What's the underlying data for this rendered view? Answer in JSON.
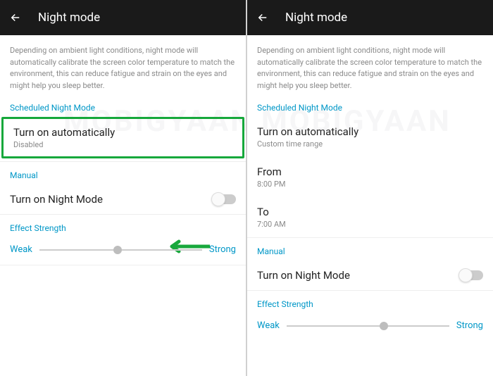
{
  "left": {
    "header": {
      "title": "Night mode"
    },
    "description": "Depending on ambient light conditions, night mode will automatically calibrate the screen color temperature to match the environment, this can reduce fatigue and strain on the eyes and might help you sleep better.",
    "scheduled_label": "Scheduled Night Mode",
    "auto": {
      "title": "Turn on automatically",
      "sub": "Disabled"
    },
    "manual_label": "Manual",
    "toggle": {
      "title": "Turn on Night Mode"
    },
    "effect_label": "Effect Strength",
    "slider": {
      "weak": "Weak",
      "strong": "Strong",
      "pos_percent": 48
    }
  },
  "right": {
    "header": {
      "title": "Night mode"
    },
    "description": "Depending on ambient light conditions, night mode will automatically calibrate the screen color temperature to match the environment, this can reduce fatigue and strain on the eyes and might help you sleep better.",
    "scheduled_label": "Scheduled Night Mode",
    "auto": {
      "title": "Turn on automatically",
      "sub": "Custom time range"
    },
    "from": {
      "title": "From",
      "sub": "8:00 PM"
    },
    "to": {
      "title": "To",
      "sub": "7:00 AM"
    },
    "manual_label": "Manual",
    "toggle": {
      "title": "Turn on Night Mode"
    },
    "effect_label": "Effect Strength",
    "slider": {
      "weak": "Weak",
      "strong": "Strong",
      "pos_percent": 60
    }
  },
  "watermark": "MOBIGYAAN"
}
